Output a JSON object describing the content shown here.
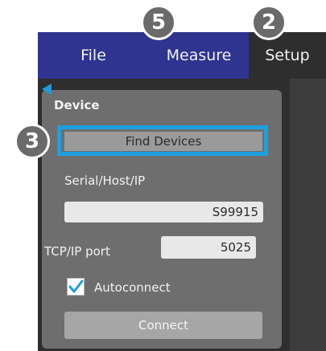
{
  "menu": {
    "tabs": [
      {
        "label": "File"
      },
      {
        "label": "Measure"
      },
      {
        "label": "Setup"
      }
    ]
  },
  "device": {
    "section_title": "Device",
    "find_devices_label": "Find Devices",
    "serial_label": "Serial/Host/IP",
    "serial_value": "S99915",
    "tcp_label": "TCP/IP port",
    "tcp_value": "5025",
    "autoconnect_label": "Autoconnect",
    "autoconnect_checked": true,
    "connect_label": "Connect"
  },
  "callouts": {
    "measure": "5",
    "setup": "2",
    "find_devices": "3"
  },
  "colors": {
    "menubar": "#2e348f",
    "highlight": "#1d9fe0",
    "panel": "#6e6e6e"
  }
}
